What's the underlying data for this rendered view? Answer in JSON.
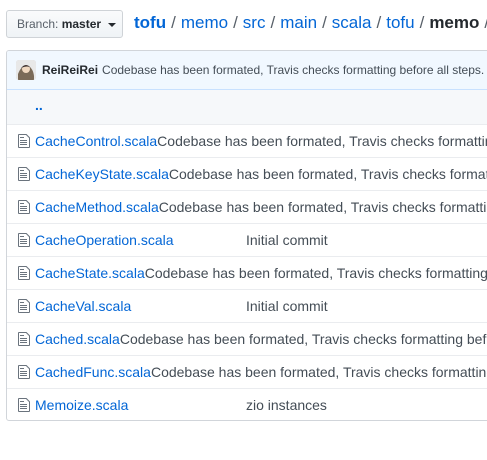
{
  "branch": {
    "prefix": "Branch:",
    "name": "master"
  },
  "breadcrumb": {
    "repo": "tofu",
    "parts": [
      "memo",
      "src",
      "main",
      "scala",
      "tofu"
    ],
    "current": "memo",
    "separator": "/"
  },
  "latest_commit": {
    "author": "ReiReiRei",
    "message": "Codebase has been formated, Travis checks formatting before all steps."
  },
  "up_link": "..",
  "files": [
    {
      "name": "CacheControl.scala",
      "message": "Codebase has been formated, Travis checks formatting before all steps."
    },
    {
      "name": "CacheKeyState.scala",
      "message": "Codebase has been formated, Travis checks formatting before all steps."
    },
    {
      "name": "CacheMethod.scala",
      "message": "Codebase has been formated, Travis checks formatting before all steps."
    },
    {
      "name": "CacheOperation.scala",
      "message": "Initial commit"
    },
    {
      "name": "CacheState.scala",
      "message": "Codebase has been formated, Travis checks formatting before all steps."
    },
    {
      "name": "CacheVal.scala",
      "message": "Initial commit"
    },
    {
      "name": "Cached.scala",
      "message": "Codebase has been formated, Travis checks formatting before all steps."
    },
    {
      "name": "CachedFunc.scala",
      "message": "Codebase has been formated, Travis checks formatting before all steps."
    },
    {
      "name": "Memoize.scala",
      "message": "zio instances"
    }
  ],
  "colors": {
    "link": "#0366d6",
    "commit_bar": "#f1f8ff",
    "border": "#d1d5da"
  }
}
